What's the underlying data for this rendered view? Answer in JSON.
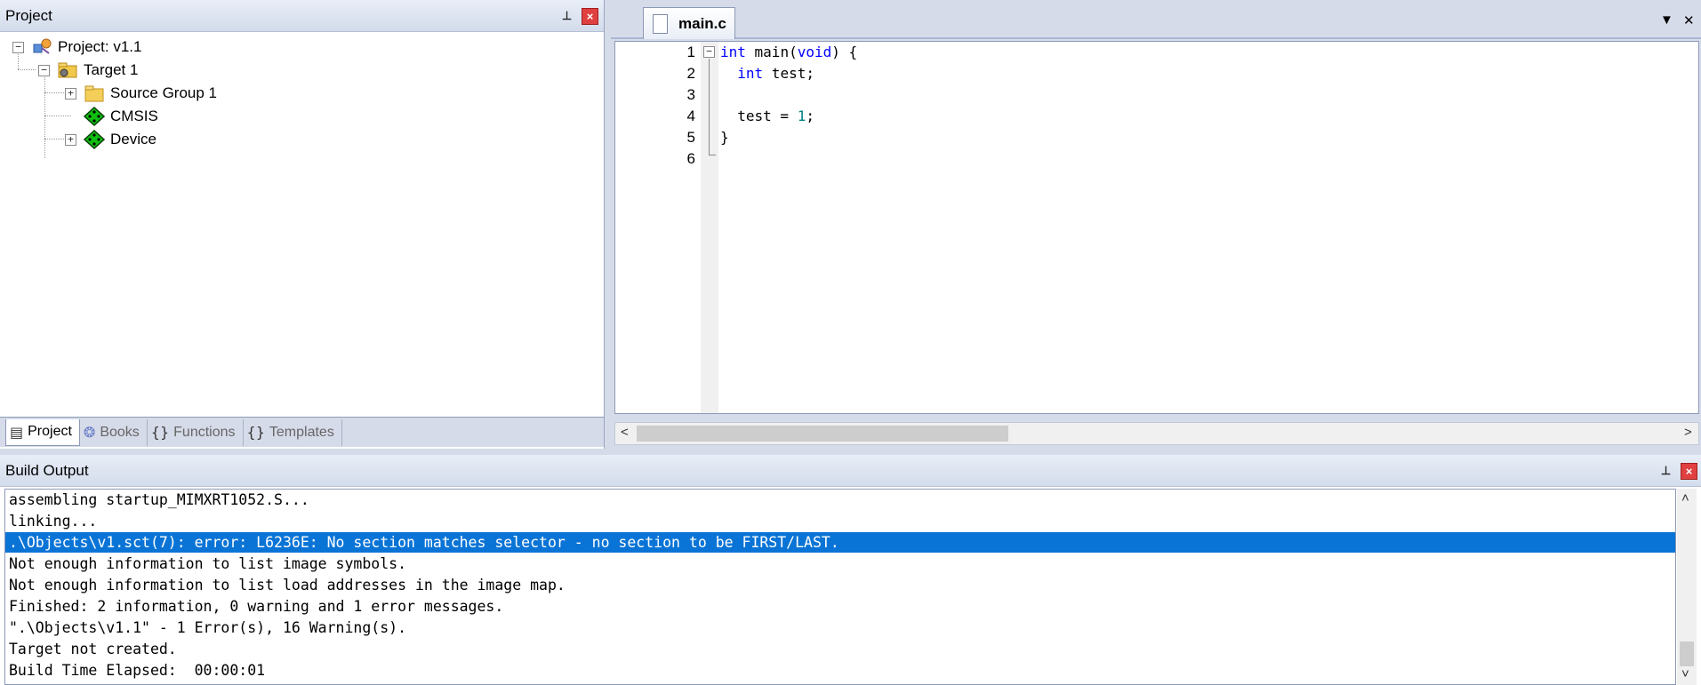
{
  "project_panel": {
    "title": "Project",
    "tree": [
      {
        "label": "Project: v1.1",
        "expander": "−"
      },
      {
        "label": "Target 1",
        "expander": "−"
      },
      {
        "label": "Source Group 1",
        "expander": "+"
      },
      {
        "label": "CMSIS"
      },
      {
        "label": "Device",
        "expander": "+"
      }
    ],
    "tabs": [
      {
        "label": "Project",
        "icon": "▤"
      },
      {
        "label": "Books",
        "icon": "❂"
      },
      {
        "label": "Functions",
        "icon": "{}"
      },
      {
        "label": "Templates",
        "icon": "{}"
      }
    ]
  },
  "editor": {
    "tab_label": "main.c",
    "dropdown_icon": "▼",
    "close_icon": "✕",
    "line_numbers": [
      "1",
      "2",
      "3",
      "4",
      "5",
      "6"
    ],
    "fold_open": "−"
  },
  "build_output": {
    "title": "Build Output",
    "lines": [
      "assembling startup_MIMXRT1052.S...",
      "linking...",
      ".\\Objects\\v1.sct(7): error: L6236E: No section matches selector - no section to be FIRST/LAST.",
      "Not enough information to list image symbols.",
      "Not enough information to list load addresses in the image map.",
      "Finished: 2 information, 0 warning and 1 error messages.",
      "\".\\Objects\\v1.1\" - 1 Error(s), 16 Warning(s).",
      "Target not created.",
      "Build Time Elapsed:  00:00:01"
    ],
    "selected_line": 2
  },
  "pin_icon": "⊥",
  "close_x": "×",
  "scroll_left": "<",
  "scroll_right": ">",
  "scroll_up": "˄",
  "scroll_down": "˅"
}
